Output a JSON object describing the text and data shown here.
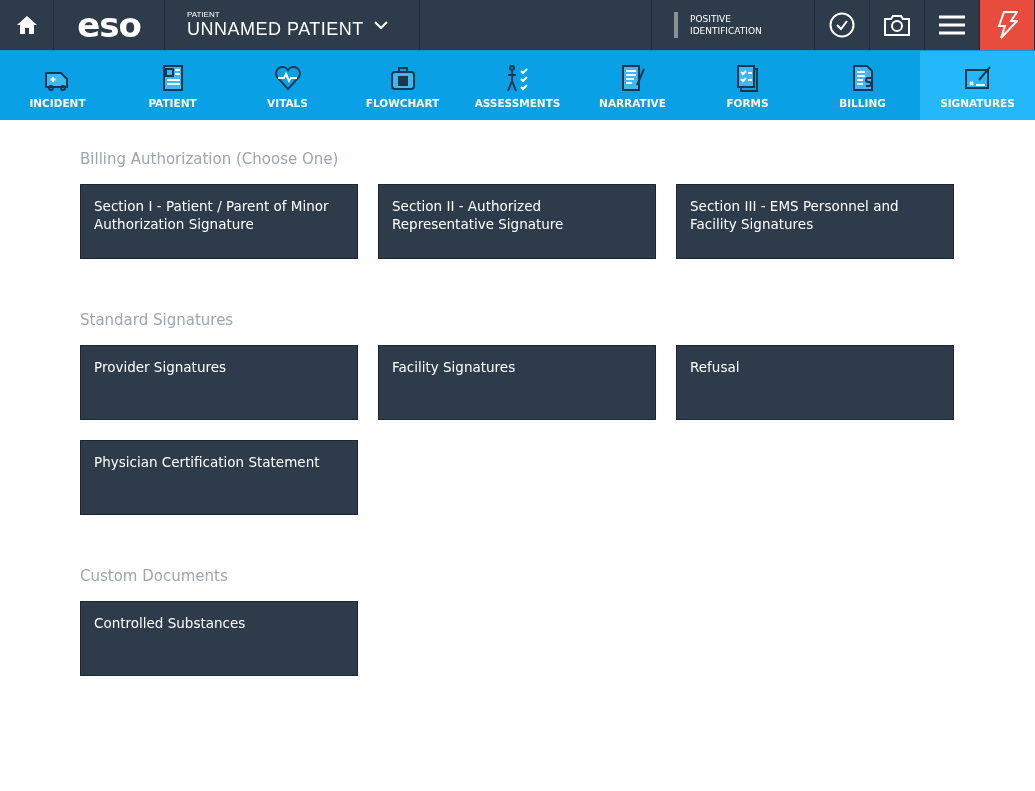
{
  "header": {
    "logo": "eso",
    "patient_label": "PATIENT",
    "patient_name": "UNNAMED PATIENT",
    "identification": "POSITIVE\nIDENTIFICATION"
  },
  "tabs": [
    {
      "label": "INCIDENT",
      "kind": "incident",
      "selected": false
    },
    {
      "label": "PATIENT",
      "kind": "patient",
      "selected": false
    },
    {
      "label": "VITALS",
      "kind": "vitals",
      "selected": false
    },
    {
      "label": "FLOWCHART",
      "kind": "flowchart",
      "selected": false
    },
    {
      "label": "ASSESSMENTS",
      "kind": "assessments",
      "selected": false
    },
    {
      "label": "NARRATIVE",
      "kind": "narrative",
      "selected": false
    },
    {
      "label": "FORMS",
      "kind": "forms",
      "selected": false
    },
    {
      "label": "BILLING",
      "kind": "billing",
      "selected": false
    },
    {
      "label": "SIGNATURES",
      "kind": "signatures",
      "selected": true
    }
  ],
  "sections": [
    {
      "title": "Billing Authorization (Choose One)",
      "cards": [
        "Section I - Patient / Parent of Minor Authorization Signature",
        "Section II - Authorized Representative Signature",
        "Section III - EMS Personnel and Facility Signatures"
      ]
    },
    {
      "title": "Standard Signatures",
      "cards": [
        "Provider Signatures",
        "Facility Signatures",
        "Refusal",
        "Physician Certification Statement"
      ]
    },
    {
      "title": "Custom Documents",
      "cards": [
        "Controlled Substances"
      ]
    }
  ]
}
